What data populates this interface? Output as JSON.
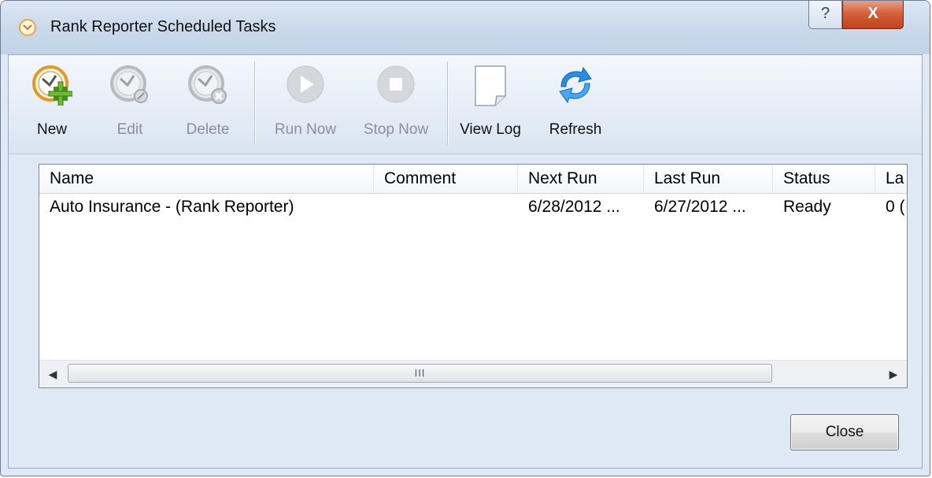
{
  "window": {
    "title": "Rank Reporter Scheduled Tasks",
    "help_label": "?",
    "close_label": "X"
  },
  "toolbar": {
    "buttons": [
      {
        "label": "New",
        "icon": "clock-add-icon",
        "enabled": true
      },
      {
        "label": "Edit",
        "icon": "clock-edit-icon",
        "enabled": false
      },
      {
        "label": "Delete",
        "icon": "clock-delete-icon",
        "enabled": false
      },
      {
        "label": "Run Now",
        "icon": "play-icon",
        "enabled": false
      },
      {
        "label": "Stop Now",
        "icon": "stop-icon",
        "enabled": false
      },
      {
        "label": "View Log",
        "icon": "document-icon",
        "enabled": true
      },
      {
        "label": "Refresh",
        "icon": "refresh-icon",
        "enabled": true
      }
    ]
  },
  "list": {
    "columns": [
      "Name",
      "Comment",
      "Next Run",
      "Last Run",
      "Status",
      "La"
    ],
    "rows": [
      {
        "name": "Auto Insurance - (Rank Reporter)",
        "comment": "",
        "next_run": "6/28/2012 ...",
        "last_run": "6/27/2012 ...",
        "status": "Ready",
        "last": "0 ("
      }
    ],
    "scroll_grip": "III"
  },
  "footer": {
    "close_label": "Close"
  },
  "colors": {
    "accent_orange": "#f0a53a",
    "window_bg": "#dfe9f5",
    "close_red": "#c2431d",
    "disabled_text": "#8a8f98"
  }
}
